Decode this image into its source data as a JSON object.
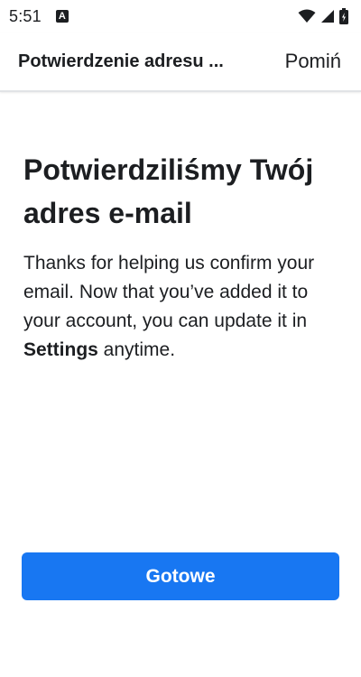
{
  "status_bar": {
    "time": "5:51",
    "notification_icon": "a-notification-icon",
    "icons": [
      "wifi-icon",
      "signal-icon",
      "battery-icon"
    ]
  },
  "header": {
    "title": "Potwierdzenie adresu ...",
    "skip_label": "Pomiń"
  },
  "main": {
    "heading": "Potwierdziliśmy Twój adres e-mail",
    "body_before": "Thanks for helping us confirm your email. Now that you’ve added it to your account, you can update it in ",
    "body_bold": "Settings",
    "body_after": " anytime."
  },
  "footer": {
    "done_label": "Gotowe"
  },
  "colors": {
    "accent": "#1877f2",
    "text": "#1c1e21",
    "divider": "#e1e3e6"
  }
}
